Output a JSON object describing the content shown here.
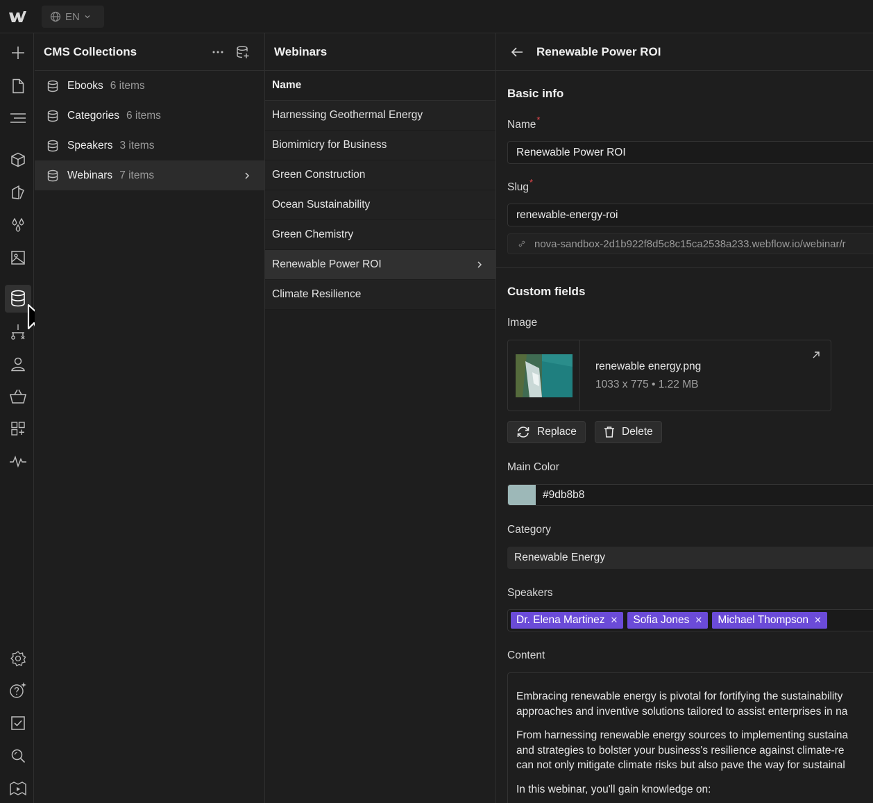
{
  "topbar": {
    "language": "EN"
  },
  "rail": {
    "icons": [
      "add-icon",
      "page-icon",
      "navigator-icon",
      "components-icon",
      "style-icon",
      "variables-icon",
      "assets-icon",
      "cms-icon",
      "logic-icon",
      "users-icon",
      "ecommerce-icon",
      "apps-icon",
      "activity-icon",
      "settings-icon",
      "help-icon",
      "audit-icon",
      "search-icon",
      "video-icon"
    ]
  },
  "collections": {
    "title": "CMS Collections",
    "items": [
      {
        "name": "Ebooks",
        "count": "6 items"
      },
      {
        "name": "Categories",
        "count": "6 items"
      },
      {
        "name": "Speakers",
        "count": "3 items"
      },
      {
        "name": "Webinars",
        "count": "7 items"
      }
    ]
  },
  "webinars": {
    "title": "Webinars",
    "column_header": "Name",
    "rows": [
      "Harnessing Geothermal Energy",
      "Biomimicry for Business",
      "Green Construction",
      "Ocean Sustainability",
      "Green Chemistry",
      "Renewable Power ROI",
      "Climate Resilience"
    ]
  },
  "editor": {
    "title": "Renewable Power ROI",
    "basic_info": "Basic info",
    "name_label": "Name",
    "name_value": "Renewable Power ROI",
    "slug_label": "Slug",
    "slug_value": "renewable-energy-roi",
    "url": "nova-sandbox-2d1b922f8d5c8c15ca2538a233.webflow.io/webinar/r",
    "custom_fields": "Custom fields",
    "image_label": "Image",
    "image_file": "renewable energy.png",
    "image_meta": "1033 x 775 • 1.22 MB",
    "replace_label": "Replace",
    "delete_label": "Delete",
    "main_color_label": "Main Color",
    "main_color_value": "#9db8b8",
    "category_label": "Category",
    "category_value": "Renewable Energy",
    "speakers_label": "Speakers",
    "speakers": [
      "Dr. Elena Martinez",
      "Sofia Jones",
      "Michael Thompson"
    ],
    "content_label": "Content",
    "content_paragraphs": [
      [
        "Embracing renewable energy is pivotal for fortifying the sustainability",
        "approaches and inventive solutions tailored to assist enterprises in na"
      ],
      [
        "From harnessing renewable energy sources to implementing sustaina",
        "and strategies to bolster your business's resilience against climate-re",
        "can not only mitigate climate risks but also pave the way for sustainal"
      ],
      [
        "In this webinar, you'll gain knowledge on:"
      ]
    ]
  },
  "colors": {
    "accent_tag": "#6b4bd8",
    "required": "#e5484d",
    "swatch": "#9db8b8"
  }
}
